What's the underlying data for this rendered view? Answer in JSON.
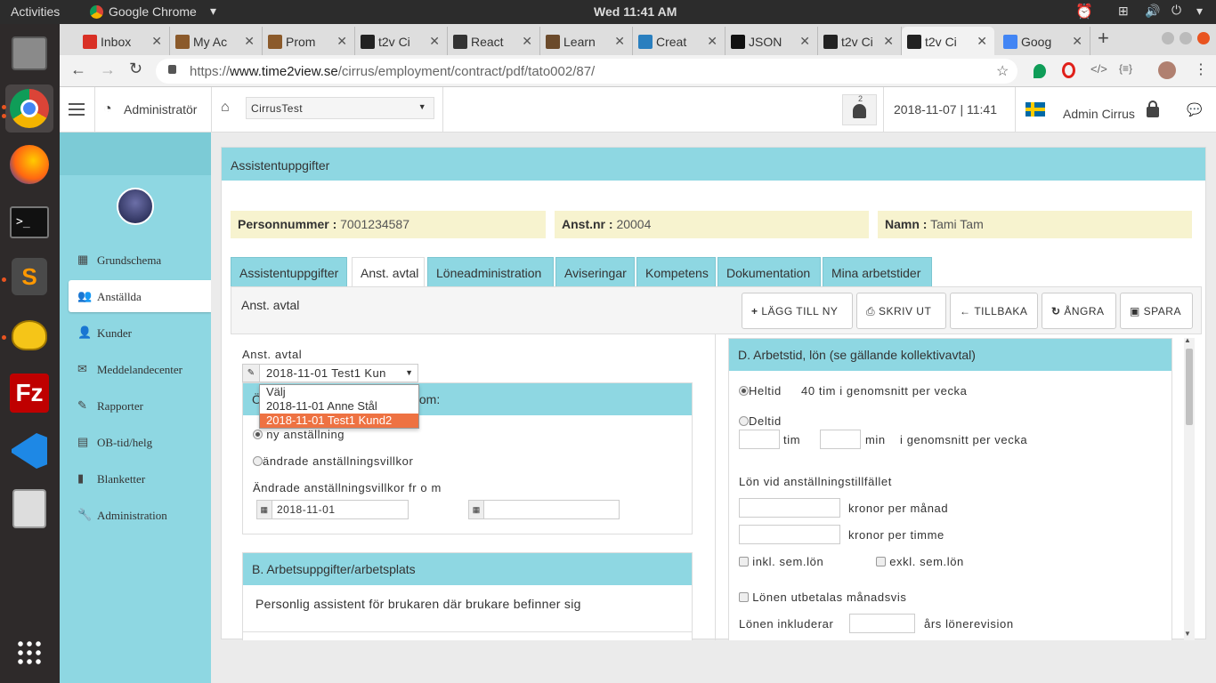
{
  "topbar": {
    "activities": "Activities",
    "app_name": "Google Chrome",
    "clock": "Wed 11:41 AM"
  },
  "browser": {
    "tabs": [
      {
        "label": "Inbox",
        "color": "#d93025"
      },
      {
        "label": "My Ac",
        "color": "#8b5a2b"
      },
      {
        "label": "Prom",
        "color": "#8b5a2b"
      },
      {
        "label": "t2v Ci",
        "color": "#222222"
      },
      {
        "label": "React",
        "color": "#333333"
      },
      {
        "label": "Learn",
        "color": "#6b4a2b"
      },
      {
        "label": "Creat",
        "color": "#2a7fbf"
      },
      {
        "label": "JSON",
        "color": "#111111"
      },
      {
        "label": "t2v Ci",
        "color": "#222222"
      },
      {
        "label": "t2v Ci",
        "color": "#222222"
      },
      {
        "label": "Goog",
        "color": "#4285f4"
      }
    ],
    "url_prefix": "https://",
    "url_host": "www.time2view.se",
    "url_path": "/cirrus/employment/contract/pdf/tato002/87/"
  },
  "app": {
    "role": "Administratör",
    "company_select": "CirrusTest",
    "notif_count": "2",
    "datetime": "2018-11-07 | 11:41",
    "user": "Admin Cirrus"
  },
  "sidebar": {
    "items": [
      {
        "label": "Grundschema",
        "icon": "calendar-icon"
      },
      {
        "label": "Anställda",
        "icon": "users-icon"
      },
      {
        "label": "Kunder",
        "icon": "user-icon"
      },
      {
        "label": "Meddelandecenter",
        "icon": "envelope-icon"
      },
      {
        "label": "Rapporter",
        "icon": "pencil-icon"
      },
      {
        "label": "OB-tid/helg",
        "icon": "chart-icon"
      },
      {
        "label": "Blanketter",
        "icon": "file-icon"
      },
      {
        "label": "Administration",
        "icon": "wrench-icon"
      }
    ]
  },
  "main": {
    "title": "Assistentuppgifter",
    "info": {
      "pnr_label": "Personnummer :",
      "pnr_value": " 7001234587",
      "anstnr_label": "Anst.nr :",
      "anstnr_value": " 20004",
      "namn_label": "Namn :",
      "namn_value": " Tami Tam"
    },
    "tabs": [
      "Assistentuppgifter",
      "Anst. avtal",
      "Löneadministration",
      "Aviseringar",
      "Kompetens",
      "Dokumentation",
      "Mina arbetstider"
    ],
    "section_title": "Anst. avtal",
    "buttons": {
      "add": "LÄGG TILL NY",
      "print": "SKRIV UT",
      "back": "TILLBAKA",
      "undo": "ÅNGRA",
      "save": "SPARA"
    },
    "contract_label": "Anst. avtal",
    "contract_selected": "2018-11-01 Test1 Kun",
    "dropdown_options": [
      "Välj",
      "2018-11-01 Anne Stål",
      "2018-11-01 Test1 Kund2"
    ],
    "box_a": {
      "title_left": "Ö",
      "title_right": "s om:",
      "opt_new": "ny anställning",
      "opt_changed": "ändrade anställningsvillkor",
      "changed_from_label": "Ändrade anställningsvillkor fr o m",
      "date_value": "2018-11-01"
    },
    "box_b": {
      "title": "B. Arbetsuppgifter/arbetsplats",
      "text": "Personlig assistent för brukaren där brukare befinner sig"
    },
    "box_d": {
      "title": "D. Arbetstid, lön (se gällande kollektivavtal)",
      "heltid": "Heltid",
      "heltid_text": "40 tim i genomsnitt per vecka",
      "deltid": "Deltid",
      "tim": "tim",
      "min": "min",
      "deltid_text": "i genomsnitt per vecka",
      "lon_label": "Lön vid anställningstillfället",
      "per_month": "kronor per månad",
      "per_hour": "kronor per timme",
      "incl": "inkl. sem.lön",
      "excl": "exkl. sem.lön",
      "monthly": "Lönen utbetalas månadsvis",
      "includes": "Lönen inkluderar",
      "revision": "års lönerevision"
    }
  }
}
